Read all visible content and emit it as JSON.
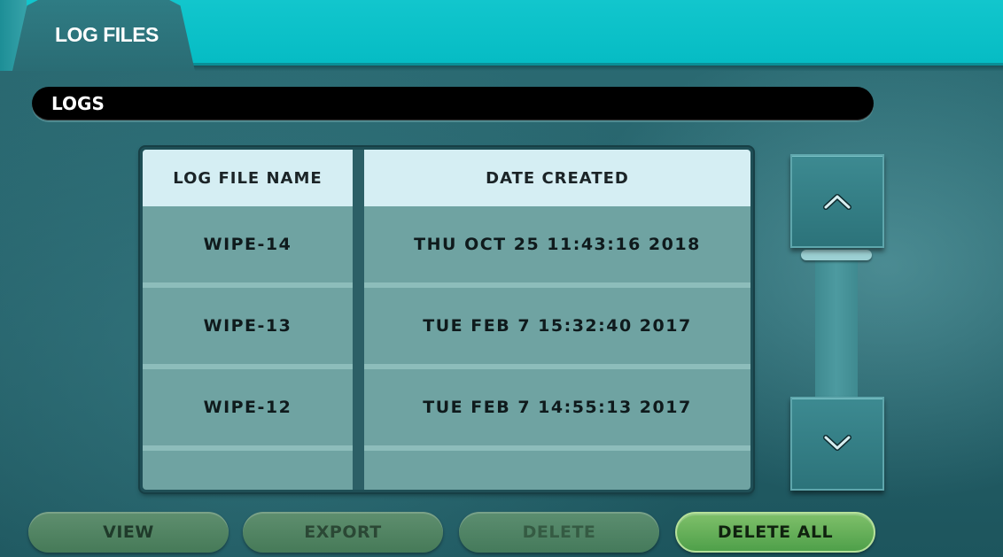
{
  "header": {
    "tab_label": "LOG FILES"
  },
  "section": {
    "title": "LOGS"
  },
  "table": {
    "columns": [
      "LOG FILE NAME",
      "DATE CREATED"
    ],
    "rows": [
      {
        "name": "WIPE-14",
        "date": "THU OCT 25 11:43:16 2018"
      },
      {
        "name": "WIPE-13",
        "date": "TUE FEB 7 15:32:40 2017"
      },
      {
        "name": "WIPE-12",
        "date": "TUE FEB 7 14:55:13 2017"
      }
    ]
  },
  "scroll": {
    "up_icon": "chevron-up-icon",
    "down_icon": "chevron-down-icon"
  },
  "actions": {
    "view_label": "VIEW",
    "export_label": "EXPORT",
    "delete_label": "DELETE",
    "delete_all_label": "DELETE ALL"
  },
  "colors": {
    "topbar": "#06bcc4",
    "table_cell": "#6fa3a2",
    "table_header": "#d5eef3",
    "delete_all_button": "#4fa04a"
  }
}
